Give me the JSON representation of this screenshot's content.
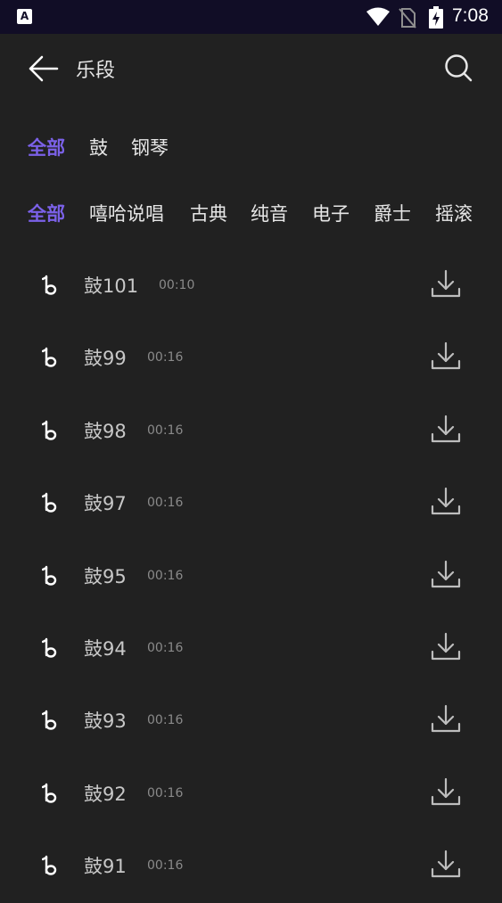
{
  "status_bar": {
    "app_badge": "A",
    "time": "7:08",
    "icons": [
      "wifi-icon",
      "no-sim-icon",
      "battery-charging-icon"
    ]
  },
  "header": {
    "title": "乐段",
    "back_icon": "back-arrow-icon",
    "search_icon": "search-icon"
  },
  "instrument_tabs": [
    {
      "label": "全部",
      "active": true
    },
    {
      "label": "鼓",
      "active": false
    },
    {
      "label": "钢琴",
      "active": false
    }
  ],
  "genre_tabs": [
    {
      "label": "全部",
      "active": true
    },
    {
      "label": "嘻哈说唱",
      "active": false
    },
    {
      "label": "古典",
      "active": false
    },
    {
      "label": "纯音",
      "active": false
    },
    {
      "label": "电子",
      "active": false
    },
    {
      "label": "爵士",
      "active": false
    },
    {
      "label": "摇滚",
      "active": false
    }
  ],
  "tracks": [
    {
      "name": "鼓101",
      "duration": "00:10"
    },
    {
      "name": "鼓99",
      "duration": "00:16"
    },
    {
      "name": "鼓98",
      "duration": "00:16"
    },
    {
      "name": "鼓97",
      "duration": "00:16"
    },
    {
      "name": "鼓95",
      "duration": "00:16"
    },
    {
      "name": "鼓94",
      "duration": "00:16"
    },
    {
      "name": "鼓93",
      "duration": "00:16"
    },
    {
      "name": "鼓92",
      "duration": "00:16"
    },
    {
      "name": "鼓91",
      "duration": "00:16"
    }
  ],
  "colors": {
    "background": "#212121",
    "status_bar": "#110d26",
    "accent": "#7b61e8",
    "text": "#e6e6e6",
    "muted": "#8a8a8a"
  }
}
